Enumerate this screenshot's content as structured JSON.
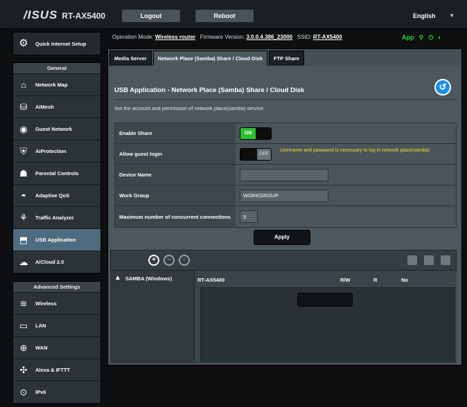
{
  "header": {
    "brand": "/ISUS",
    "model": "RT-AX5400",
    "logout_label": "Logout",
    "reboot_label": "Reboot",
    "language": "English"
  },
  "status_line": {
    "op_mode_label": "Operation Mode:",
    "op_mode_value": "Wireless router",
    "firmware_label": "Firmware Version:",
    "firmware_value": "3.0.0.4.386_23000",
    "ssid_label": "SSID:",
    "ssid_value": "RT-AX5400",
    "app_label": "App"
  },
  "sidebar": {
    "qis_label": "Quick Internet Setup",
    "general_title": "General",
    "general_items": [
      {
        "label": "Network Map",
        "icon": "network-map-icon"
      },
      {
        "label": "AiMesh",
        "icon": "aimesh-icon"
      },
      {
        "label": "Guest Network",
        "icon": "guest-network-icon"
      },
      {
        "label": "AiProtection",
        "icon": "aiprotection-icon"
      },
      {
        "label": "Parental Controls",
        "icon": "parental-controls-icon"
      },
      {
        "label": "Adaptive QoS",
        "icon": "adaptive-qos-icon"
      },
      {
        "label": "Traffic Analyzer",
        "icon": "traffic-analyzer-icon"
      },
      {
        "label": "USB Application",
        "icon": "usb-application-icon"
      },
      {
        "label": "AiCloud 2.0",
        "icon": "aicloud-icon"
      }
    ],
    "advanced_title": "Advanced Settings",
    "advanced_items": [
      {
        "label": "Wireless",
        "icon": "wireless-icon"
      },
      {
        "label": "LAN",
        "icon": "lan-icon"
      },
      {
        "label": "WAN",
        "icon": "wan-icon"
      },
      {
        "label": "Alexa & IFTTT",
        "icon": "alexa-icon"
      },
      {
        "label": "IPv6",
        "icon": "ipv6-icon"
      }
    ]
  },
  "tabs": [
    "Media Server",
    "Network Place (Samba) Share / Cloud Disk",
    "FTP Share"
  ],
  "page": {
    "title": "USB Application - Network Place (Samba) Share / Cloud Disk",
    "description": "Set the account and permission of network place(samba) service.",
    "rows": [
      {
        "label": "Enable Share",
        "toggle": "ON"
      },
      {
        "label": "Allow guest login",
        "toggle": "OFF",
        "warning": "Username and password is necessary to log in network place(samba)"
      },
      {
        "label": "Device Name",
        "value": ""
      },
      {
        "label": "Work Group",
        "value": "WORKGROUP"
      },
      {
        "label": "Maximum number of concurrent connections",
        "value": "5"
      }
    ],
    "apply_label": "Apply"
  },
  "share": {
    "tree_node": "SAMBA (Windows)",
    "device_name": "RT-AX5400",
    "device_col1": "R/W",
    "device_col2": "R",
    "device_col3": "No"
  }
}
